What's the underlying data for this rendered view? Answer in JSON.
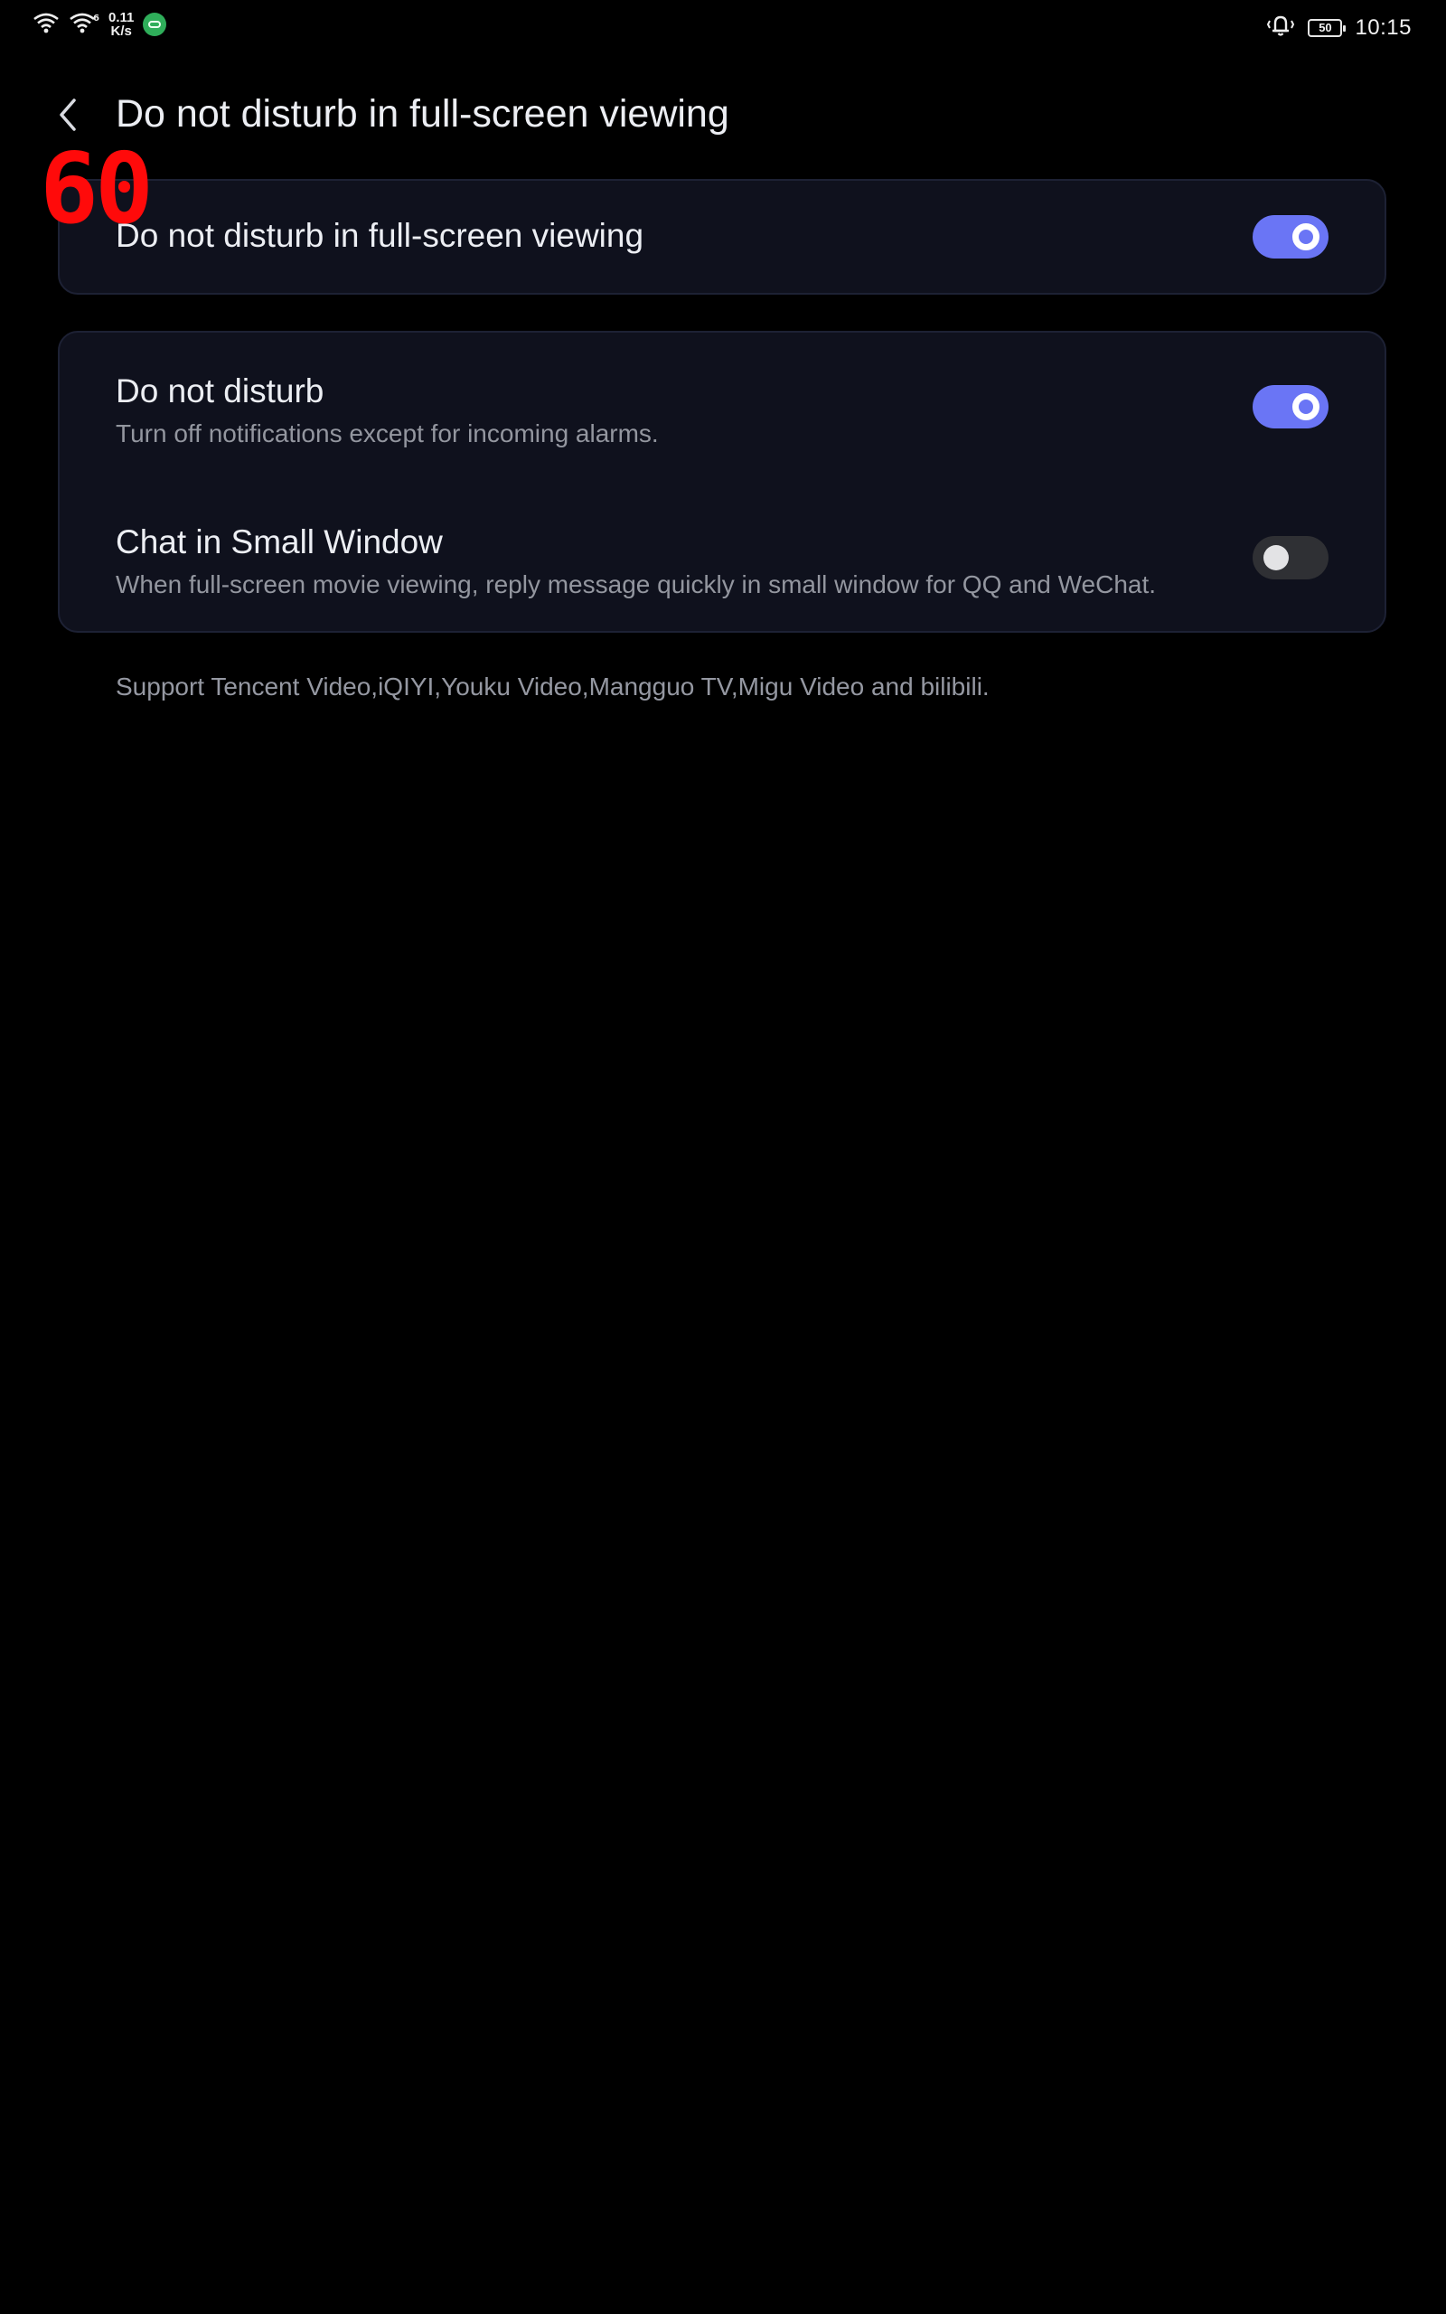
{
  "status_bar": {
    "net_speed_value": "0.11",
    "net_speed_unit": "K/s",
    "battery": "50",
    "time": "10:15",
    "icons": [
      "wifi-icon",
      "wifi-6-icon",
      "app-notification-icon",
      "bell-icon",
      "battery-icon"
    ]
  },
  "header": {
    "title": "Do not disturb in full-screen viewing",
    "back_icon": "chevron-left-icon"
  },
  "overlay": {
    "fps": "60"
  },
  "settings": {
    "master": {
      "title": "Do not disturb in full-screen viewing",
      "enabled": true
    },
    "items": [
      {
        "title": "Do not disturb",
        "subtitle": "Turn off notifications except for incoming alarms.",
        "enabled": true
      },
      {
        "title": "Chat in Small Window",
        "subtitle": "When full-screen movie viewing, reply message quickly in small window for QQ and WeChat.",
        "enabled": false
      }
    ]
  },
  "footnote": "Support Tencent Video,iQIYI,Youku Video,Mangguo TV,Migu Video and bilibili.",
  "colors": {
    "background": "#000000",
    "card": "#0f111d",
    "accent": "#6a75f5",
    "toggle_off": "#2f3034",
    "fps_overlay": "#ff0a0a"
  }
}
